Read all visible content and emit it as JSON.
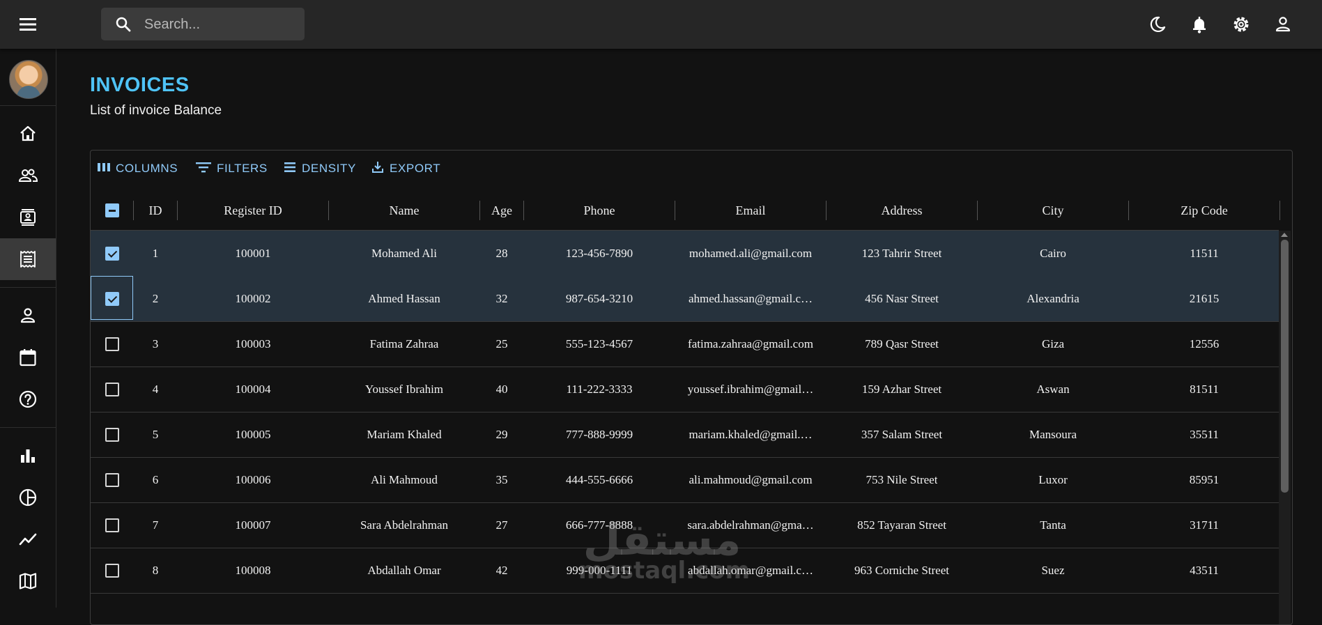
{
  "search": {
    "placeholder": "Search..."
  },
  "topbar": {
    "icons": [
      "menu-icon",
      "moon-icon",
      "bell-icon",
      "gear-icon",
      "user-icon"
    ]
  },
  "sidebar": {
    "icons": [
      "home-icon",
      "team-icon",
      "contacts-icon",
      "invoices-icon",
      "person-icon",
      "calendar-icon",
      "help-icon",
      "bar-chart-icon",
      "pie-chart-icon",
      "line-chart-icon",
      "map-icon"
    ],
    "active": "invoices-icon"
  },
  "page": {
    "title": "INVOICES",
    "subtitle": "List of invoice Balance"
  },
  "toolbar": {
    "columns": "COLUMNS",
    "filters": "FILTERS",
    "density": "DENSITY",
    "export": "EXPORT"
  },
  "table": {
    "headers": [
      "ID",
      "Register ID",
      "Name",
      "Age",
      "Phone",
      "Email",
      "Address",
      "City",
      "Zip Code"
    ],
    "header_checkbox": "indeterminate",
    "rows": [
      {
        "selected": true,
        "id": "1",
        "register_id": "100001",
        "name": "Mohamed Ali",
        "age": "28",
        "phone": "123-456-7890",
        "email": "mohamed.ali@gmail.com",
        "address": "123 Tahrir Street",
        "city": "Cairo",
        "zip": "11511"
      },
      {
        "selected": true,
        "id": "2",
        "register_id": "100002",
        "name": "Ahmed Hassan",
        "age": "32",
        "phone": "987-654-3210",
        "email": "ahmed.hassan@gmail.c…",
        "address": "456 Nasr Street",
        "city": "Alexandria",
        "zip": "21615"
      },
      {
        "selected": false,
        "id": "3",
        "register_id": "100003",
        "name": "Fatima Zahraa",
        "age": "25",
        "phone": "555-123-4567",
        "email": "fatima.zahraa@gmail.com",
        "address": "789 Qasr Street",
        "city": "Giza",
        "zip": "12556"
      },
      {
        "selected": false,
        "id": "4",
        "register_id": "100004",
        "name": "Youssef Ibrahim",
        "age": "40",
        "phone": "111-222-3333",
        "email": "youssef.ibrahim@gmail…",
        "address": "159 Azhar Street",
        "city": "Aswan",
        "zip": "81511"
      },
      {
        "selected": false,
        "id": "5",
        "register_id": "100005",
        "name": "Mariam Khaled",
        "age": "29",
        "phone": "777-888-9999",
        "email": "mariam.khaled@gmail.…",
        "address": "357 Salam Street",
        "city": "Mansoura",
        "zip": "35511"
      },
      {
        "selected": false,
        "id": "6",
        "register_id": "100006",
        "name": "Ali Mahmoud",
        "age": "35",
        "phone": "444-555-6666",
        "email": "ali.mahmoud@gmail.com",
        "address": "753 Nile Street",
        "city": "Luxor",
        "zip": "85951"
      },
      {
        "selected": false,
        "id": "7",
        "register_id": "100007",
        "name": "Sara Abdelrahman",
        "age": "27",
        "phone": "666-777-8888",
        "email": "sara.abdelrahman@gma…",
        "address": "852 Tayaran Street",
        "city": "Tanta",
        "zip": "31711"
      },
      {
        "selected": false,
        "id": "8",
        "register_id": "100008",
        "name": "Abdallah Omar",
        "age": "42",
        "phone": "999-000-1111",
        "email": "abdallah.omar@gmail.c…",
        "address": "963 Corniche Street",
        "city": "Suez",
        "zip": "43511"
      }
    ]
  },
  "watermark": {
    "arabic": "مستقل",
    "latin": "mostaql.com"
  },
  "colors": {
    "accent": "#4fc3f7",
    "toolbar_text": "#90caf9",
    "selected_row": "#26323d",
    "topbar": "#262626",
    "background": "#121212"
  }
}
